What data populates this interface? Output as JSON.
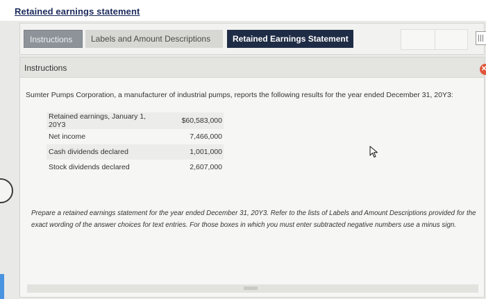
{
  "page": {
    "title": "Retained earnings statement"
  },
  "tabs": [
    {
      "label": "Instructions"
    },
    {
      "label": "Labels and Amount Descriptions"
    },
    {
      "label": "Retained Earnings Statement"
    }
  ],
  "panel": {
    "header": "Instructions",
    "intro": "Sumter Pumps Corporation, a manufacturer of industrial pumps, reports the following results for the year ended December 31, 20Y3:",
    "rows": [
      {
        "label": "Retained earnings, January 1, 20Y3",
        "amount": "$60,583,000"
      },
      {
        "label": "Net income",
        "amount": "7,466,000"
      },
      {
        "label": "Cash dividends declared",
        "amount": "1,001,000"
      },
      {
        "label": "Stock dividends declared",
        "amount": "2,607,000"
      }
    ],
    "prompt": "Prepare a retained earnings statement for the year ended December 31, 20Y3. Refer to the lists of Labels and Amount Descriptions provided for the exact wording of the answer choices for text entries. For those boxes in which you must enter subtracted negative numbers use a minus sign."
  },
  "icons": {
    "cursor": "mouse-pointer-icon",
    "badge": "close-badge-icon",
    "grip": "grip-icon"
  },
  "colors": {
    "active_tab": "#1f2c45",
    "title": "#1b2a5c",
    "badge": "#e0563a"
  }
}
